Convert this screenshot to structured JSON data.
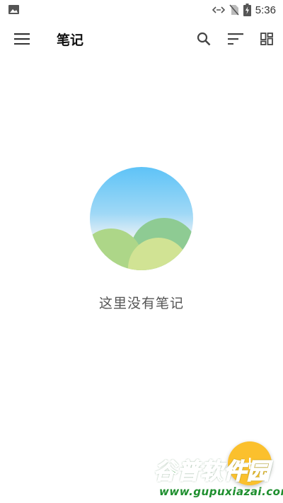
{
  "status_bar": {
    "time": "5:36",
    "icons": [
      "gallery-icon",
      "data-transfer-icon",
      "no-sim-icon",
      "battery-charging-icon"
    ]
  },
  "app_bar": {
    "title": "笔记",
    "icons": [
      "menu-icon",
      "search-icon",
      "sort-icon",
      "grid-view-icon"
    ]
  },
  "empty_state": {
    "message": "这里没有笔记",
    "illustration": "landscape-hills-icon"
  },
  "fab": {
    "icon": "add-icon",
    "color": "#fbc02d"
  },
  "watermark": {
    "brand": "谷普软件园",
    "url": "www.gupuxiazai.com"
  }
}
